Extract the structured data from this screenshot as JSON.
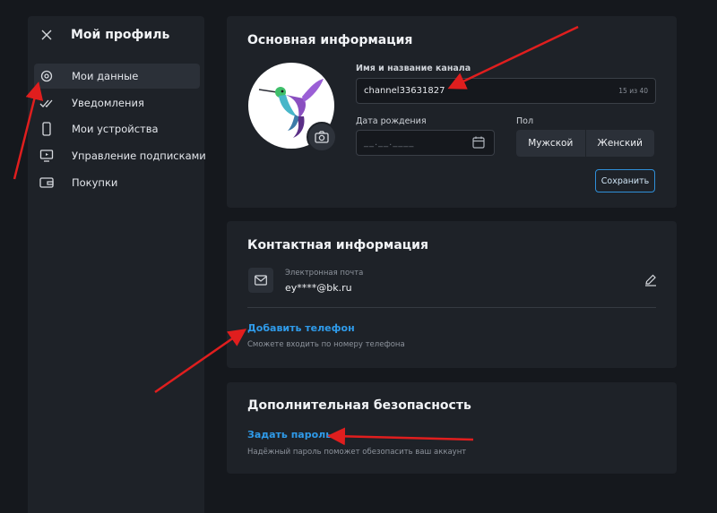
{
  "sidebar": {
    "title": "Мой профиль",
    "items": [
      {
        "label": "Мои данные",
        "icon": "gear-icon",
        "active": true
      },
      {
        "label": "Уведомления",
        "icon": "check-icon"
      },
      {
        "label": "Мои устройства",
        "icon": "phone-icon"
      },
      {
        "label": "Управление подписками",
        "icon": "tv-icon"
      },
      {
        "label": "Покупки",
        "icon": "wallet-icon"
      }
    ]
  },
  "basic": {
    "title": "Основная информация",
    "name_label": "Имя и название канала",
    "name_value": "channel33631827",
    "name_counter": "15 из 40",
    "dob_label": "Дата рождения",
    "dob_placeholder": "__.__.____",
    "gender_label": "Пол",
    "gender_male": "Мужской",
    "gender_female": "Женский",
    "save_label": "Сохранить"
  },
  "contact": {
    "title": "Контактная информация",
    "email_label": "Электронная почта",
    "email_value": "ey****@bk.ru",
    "add_phone": "Добавить телефон",
    "phone_hint": "Сможете входить по номеру телефона"
  },
  "security": {
    "title": "Дополнительная безопасность",
    "set_password": "Задать пароль",
    "password_hint": "Надёжный пароль поможет обезопасить ваш аккаунт"
  },
  "colors": {
    "background": "#15181d",
    "panel": "#1e2228",
    "accent": "#2f9bea",
    "annotation": "#e01e1e"
  }
}
